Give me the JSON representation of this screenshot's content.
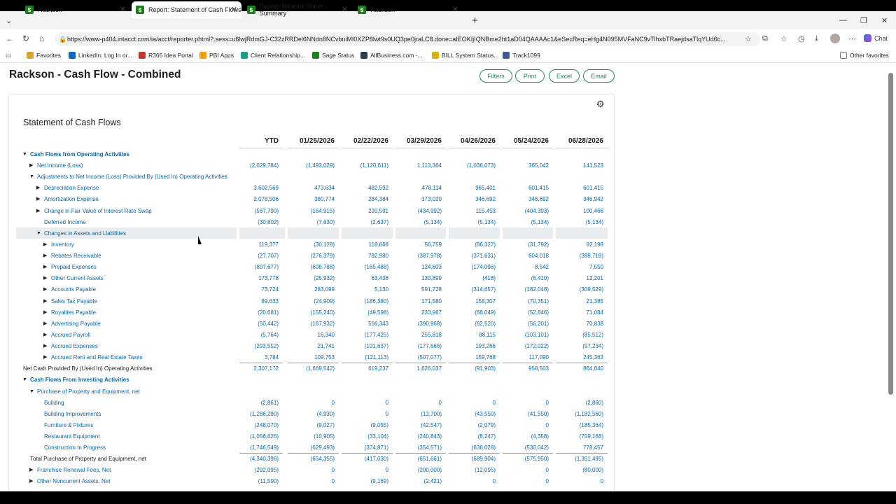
{
  "browser": {
    "tabs": [
      {
        "label": "Rackson",
        "active": false
      },
      {
        "label": "Report: Statement of Cash Flows",
        "active": true
      },
      {
        "label": "Report: Balance Sheet - Summary",
        "active": false
      },
      {
        "label": "Rackson",
        "active": false
      }
    ],
    "url": "https://www-p404.intacct.com/ia/acct/reporter.phtml?.sess=u6lwjRdmGJ-C32zRRDel6NNdn8NCvbuiMI0XZP8lwt9s0UQ3pe0jraLC8.done=aIEOKIjIQNBme2ht1aD04QAAAAc1&eSecReq=eHg4N095MVFaNC9vTlhxbTRaejdsaTlqYUd6c...",
    "chat_label": "Chat",
    "favorites": [
      "Favorites",
      "LinkedIn: Log In or...",
      "R365 Idea Portal",
      "PBI Apps",
      "Client Relationship...",
      "Sage Status",
      "AllBusiness.com -...",
      "BILL System Status...",
      "Track1099"
    ],
    "other_favorites": "Other favorites"
  },
  "page": {
    "title": "Rackson - Cash Flow - Combined",
    "buttons": {
      "filters": "Filters",
      "print": "Print",
      "excel": "Excel",
      "email": "Email"
    }
  },
  "report": {
    "title": "Statement of Cash Flows",
    "columns": [
      "YTD",
      "01/25/2026",
      "02/22/2026",
      "03/29/2026",
      "04/26/2026",
      "05/24/2026",
      "06/28/2026"
    ],
    "rows": [
      {
        "label": "Cash Flows from Operating Activities",
        "level": 0,
        "toggle": "down",
        "style": "link-bold",
        "values": []
      },
      {
        "label": "Net Income (Loss)",
        "level": 1,
        "toggle": "right",
        "style": "link",
        "values": [
          "(2,029,784)",
          "(1,493,029)",
          "(1,120,611)",
          "1,113,364",
          "(1,036,073)",
          "365,042",
          "141,523"
        ]
      },
      {
        "label": "Adjustments to Net Income (Loss) Provided By (Used In) Operating Activities",
        "level": 1,
        "toggle": "down",
        "style": "link",
        "values": []
      },
      {
        "label": "Depreciation Expense",
        "level": 2,
        "toggle": "right",
        "style": "link",
        "values": [
          "3,602,569",
          "473,634",
          "482,592",
          "478,114",
          "965,401",
          "601,415",
          "601,415"
        ]
      },
      {
        "label": "Amortization Expense",
        "level": 2,
        "toggle": "right",
        "style": "link",
        "values": [
          "2,078,506",
          "380,774",
          "284,384",
          "373,020",
          "346,692",
          "346,692",
          "346,942"
        ]
      },
      {
        "label": "Change in Fair Value of Interest Rate Swap",
        "level": 2,
        "toggle": "right",
        "style": "link",
        "values": [
          "(567,790)",
          "(164,915)",
          "220,591",
          "(434,992)",
          "115,453",
          "(404,393)",
          "100,466"
        ]
      },
      {
        "label": "Deferred Income",
        "level": 2,
        "toggle": "none",
        "style": "link",
        "values": [
          "(30,802)",
          "(7,630)",
          "(2,637)",
          "(5,134)",
          "(5,134)",
          "(5,134)",
          "(5,134)"
        ]
      },
      {
        "label": "Changes in Assets and Liabilities",
        "level": 2,
        "toggle": "down",
        "style": "link",
        "values": []
      },
      {
        "label": "Inventory",
        "level": 3,
        "toggle": "right",
        "style": "link",
        "values": [
          "119,377",
          "(30,129)",
          "118,668",
          "56,759",
          "(86,327)",
          "(31,792)",
          "92,198"
        ]
      },
      {
        "label": "Rebates Receivable",
        "level": 3,
        "toggle": "right",
        "style": "link",
        "values": [
          "(27,707)",
          "(276,379)",
          "792,980",
          "(387,978)",
          "(371,631)",
          "604,018",
          "(388,716)"
        ]
      },
      {
        "label": "Prepaid Expenses",
        "level": 3,
        "toggle": "right",
        "style": "link",
        "values": [
          "(807,677)",
          "(608,788)",
          "(165,488)",
          "124,603",
          "(174,096)",
          "8,542",
          "7,550"
        ]
      },
      {
        "label": "Other Current Assets",
        "level": 3,
        "toggle": "right",
        "style": "link",
        "values": [
          "173,778",
          "(25,932)",
          "63,438",
          "130,899",
          "(418)",
          "(6,410)",
          "12,201"
        ]
      },
      {
        "label": "Accounts Payable",
        "level": 3,
        "toggle": "right",
        "style": "link",
        "values": [
          "73,724",
          "283,099",
          "5,130",
          "591,728",
          "(314,657)",
          "(182,048)",
          "(309,529)"
        ]
      },
      {
        "label": "Sales Tax Payable",
        "level": 3,
        "toggle": "right",
        "style": "link",
        "values": [
          "89,633",
          "(24,909)",
          "(186,380)",
          "171,580",
          "158,307",
          "(70,351)",
          "21,385"
        ]
      },
      {
        "label": "Royalties Payable",
        "level": 3,
        "toggle": "right",
        "style": "link",
        "values": [
          "(20,681)",
          "(155,240)",
          "(49,598)",
          "233,967",
          "(68,049)",
          "(52,846)",
          "71,084"
        ]
      },
      {
        "label": "Advertising Payable",
        "level": 3,
        "toggle": "right",
        "style": "link",
        "values": [
          "(50,442)",
          "(167,932)",
          "556,343",
          "(390,968)",
          "(62,520)",
          "(56,201)",
          "70,838"
        ]
      },
      {
        "label": "Accrued Payroll",
        "level": 3,
        "toggle": "right",
        "style": "link",
        "values": [
          "(5,764)",
          "16,340",
          "(177,425)",
          "255,818",
          "88,115",
          "(103,101)",
          "(85,512)"
        ]
      },
      {
        "label": "Accrued Expenses",
        "level": 3,
        "toggle": "right",
        "style": "link",
        "values": [
          "(293,552)",
          "21,741",
          "(101,637)",
          "(177,666)",
          "193,266",
          "(172,022)",
          "(57,234)"
        ]
      },
      {
        "label": "Accrued Rent and Real Estate Taxes",
        "level": 3,
        "toggle": "right",
        "style": "link",
        "values": [
          "3,784",
          "109,753",
          "(121,113)",
          "(507,077)",
          "159,768",
          "117,090",
          "245,363"
        ]
      },
      {
        "label": "Net Cash Provided By (Used In) Operating Activities",
        "level": -1,
        "toggle": "none",
        "style": "plain",
        "values": [
          "2,307,172",
          "(1,669,542)",
          "619,237",
          "1,626,037",
          "(91,903)",
          "958,503",
          "864,840"
        ]
      },
      {
        "label": "Cash Flows From Investing Activities",
        "level": 0,
        "toggle": "down",
        "style": "link-bold",
        "values": []
      },
      {
        "label": "Purchase of Property and Equipment, net",
        "level": 1,
        "toggle": "down",
        "style": "link",
        "values": []
      },
      {
        "label": "Building",
        "level": 2,
        "toggle": "none",
        "style": "link",
        "values": [
          "(2,861)",
          "0",
          "0",
          "0",
          "0",
          "0",
          "(2,860)"
        ]
      },
      {
        "label": "Building Improvements",
        "level": 2,
        "toggle": "none",
        "style": "link",
        "values": [
          "(1,286,290)",
          "(4,930)",
          "0",
          "(13,700)",
          "(43,550)",
          "(41,550)",
          "(1,182,560)"
        ]
      },
      {
        "label": "Furniture & Fixtures",
        "level": 2,
        "toggle": "none",
        "style": "link",
        "values": [
          "(248,070)",
          "(9,027)",
          "(9,055)",
          "(42,547)",
          "(2,079)",
          "0",
          "(185,364)"
        ]
      },
      {
        "label": "Restaurant Equipment",
        "level": 2,
        "toggle": "none",
        "style": "link",
        "values": [
          "(1,056,626)",
          "(10,905)",
          "(33,104)",
          "(240,843)",
          "(8,247)",
          "(4,358)",
          "(759,168)"
        ]
      },
      {
        "label": "Construction In Progress",
        "level": 2,
        "toggle": "none",
        "style": "link",
        "values": [
          "(1,746,549)",
          "(629,493)",
          "(374,871)",
          "(354,571)",
          "(636,028)",
          "(530,042)",
          "778,457"
        ]
      },
      {
        "label": "Total Purchase of Property and Equipment, net",
        "level": 1,
        "toggle": "none",
        "style": "plain",
        "values": [
          "(4,340,396)",
          "(654,355)",
          "(417,030)",
          "(651,661)",
          "(689,904)",
          "(575,950)",
          "(1,351,495)"
        ]
      },
      {
        "label": "Franchise Renewal Fees, Net",
        "level": 1,
        "toggle": "right",
        "style": "link",
        "values": [
          "(292,095)",
          "0",
          "0",
          "(200,000)",
          "(12,095)",
          "0",
          "(80,000)"
        ]
      },
      {
        "label": "Other Noncurrent Assets, Net",
        "level": 1,
        "toggle": "right",
        "style": "link",
        "values": [
          "(11,590)",
          "0",
          "(9,169)",
          "(2,421)",
          "0",
          "0",
          "0"
        ]
      }
    ]
  }
}
